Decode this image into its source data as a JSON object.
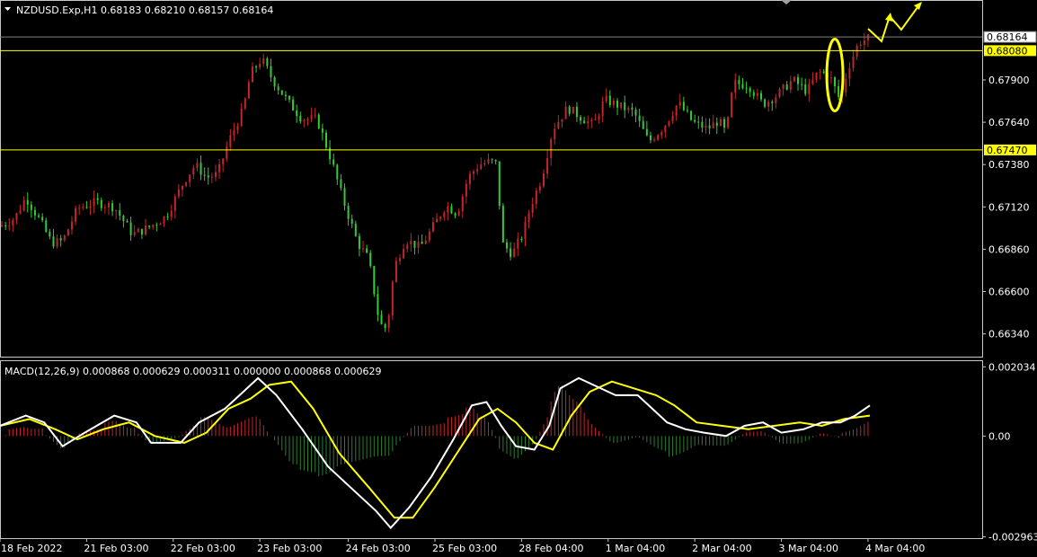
{
  "header": {
    "symbol_line": "NZDUSD.Exp,H1  0.68183 0.68210 0.68157 0.68164"
  },
  "macd_header": {
    "label": "MACD(12,26,9) 0.000868 0.000629 0.000311 0.000000 0.000868 0.000629"
  },
  "colors": {
    "background": "#000000",
    "bull_candle": "#c1272d",
    "bear_candle": "#32cd32",
    "horizontal_level": "#ffff00",
    "price_line": "#808080",
    "macd_line": "#ffffff",
    "signal_line": "#ffff00",
    "hist_positive": "#c1272d",
    "hist_negative": "#2e7d32",
    "annotation": "#ffff00"
  },
  "chart_data": [
    {
      "type": "candlestick",
      "symbol": "NZDUSD.Exp",
      "timeframe": "H1",
      "last_ohlc": {
        "open": 0.68183,
        "high": 0.6821,
        "low": 0.68157,
        "close": 0.68164
      },
      "ylim": [
        0.662,
        0.6838
      ],
      "y_ticks": [
        "0.68164",
        "0.67900",
        "0.67640",
        "0.67380",
        "0.67120",
        "0.66860",
        "0.66600",
        "0.66340"
      ],
      "x_ticks": [
        "18 Feb 2022",
        "21 Feb 03:00",
        "22 Feb 03:00",
        "23 Feb 03:00",
        "24 Feb 03:00",
        "25 Feb 03:00",
        "28 Feb 04:00",
        "1 Mar 04:00",
        "2 Mar 04:00",
        "3 Mar 04:00",
        "4 Mar 04:00"
      ],
      "current_price": {
        "value": 0.68164,
        "label": "0.68164"
      },
      "horizontal_levels": [
        {
          "value": 0.6808,
          "label": "0.68080"
        },
        {
          "value": 0.6747,
          "label": "0.67470"
        }
      ],
      "price_path": [
        {
          "x": 0,
          "y": 0.67
        },
        {
          "x": 8,
          "y": 0.6705
        },
        {
          "x": 14,
          "y": 0.6718
        },
        {
          "x": 22,
          "y": 0.6703
        },
        {
          "x": 28,
          "y": 0.669
        },
        {
          "x": 34,
          "y": 0.6691
        },
        {
          "x": 42,
          "y": 0.6711
        },
        {
          "x": 52,
          "y": 0.6715
        },
        {
          "x": 62,
          "y": 0.6712
        },
        {
          "x": 72,
          "y": 0.6695
        },
        {
          "x": 80,
          "y": 0.6699
        },
        {
          "x": 90,
          "y": 0.6706
        },
        {
          "x": 100,
          "y": 0.6728
        },
        {
          "x": 106,
          "y": 0.6738
        },
        {
          "x": 112,
          "y": 0.673
        },
        {
          "x": 118,
          "y": 0.6732
        },
        {
          "x": 124,
          "y": 0.6752
        },
        {
          "x": 132,
          "y": 0.6772
        },
        {
          "x": 136,
          "y": 0.6794
        },
        {
          "x": 142,
          "y": 0.6803
        },
        {
          "x": 148,
          "y": 0.679
        },
        {
          "x": 156,
          "y": 0.6777
        },
        {
          "x": 164,
          "y": 0.6766
        },
        {
          "x": 172,
          "y": 0.6766
        },
        {
          "x": 180,
          "y": 0.674
        },
        {
          "x": 186,
          "y": 0.6717
        },
        {
          "x": 194,
          "y": 0.669
        },
        {
          "x": 200,
          "y": 0.668
        },
        {
          "x": 206,
          "y": 0.664
        },
        {
          "x": 210,
          "y": 0.6637
        },
        {
          "x": 214,
          "y": 0.6675
        },
        {
          "x": 220,
          "y": 0.6692
        },
        {
          "x": 228,
          "y": 0.6687
        },
        {
          "x": 234,
          "y": 0.6698
        },
        {
          "x": 242,
          "y": 0.6713
        },
        {
          "x": 248,
          "y": 0.6708
        },
        {
          "x": 254,
          "y": 0.673
        },
        {
          "x": 260,
          "y": 0.6738
        },
        {
          "x": 266,
          "y": 0.674
        },
        {
          "x": 270,
          "y": 0.6738
        },
        {
          "x": 272,
          "y": 0.669
        },
        {
          "x": 278,
          "y": 0.6683
        },
        {
          "x": 284,
          "y": 0.6696
        },
        {
          "x": 288,
          "y": 0.6713
        },
        {
          "x": 294,
          "y": 0.673
        },
        {
          "x": 300,
          "y": 0.676
        },
        {
          "x": 308,
          "y": 0.6773
        },
        {
          "x": 314,
          "y": 0.6768
        },
        {
          "x": 322,
          "y": 0.6762
        },
        {
          "x": 328,
          "y": 0.6778
        },
        {
          "x": 336,
          "y": 0.6774
        },
        {
          "x": 344,
          "y": 0.677
        },
        {
          "x": 352,
          "y": 0.6752
        },
        {
          "x": 360,
          "y": 0.6761
        },
        {
          "x": 368,
          "y": 0.6776
        },
        {
          "x": 376,
          "y": 0.6764
        },
        {
          "x": 384,
          "y": 0.676
        },
        {
          "x": 390,
          "y": 0.6765
        },
        {
          "x": 394,
          "y": 0.6757
        },
        {
          "x": 398,
          "y": 0.6788
        },
        {
          "x": 406,
          "y": 0.6787
        },
        {
          "x": 414,
          "y": 0.6775
        },
        {
          "x": 422,
          "y": 0.6781
        },
        {
          "x": 430,
          "y": 0.679
        },
        {
          "x": 438,
          "y": 0.6783
        },
        {
          "x": 444,
          "y": 0.6795
        },
        {
          "x": 450,
          "y": 0.6793
        },
        {
          "x": 456,
          "y": 0.6777
        },
        {
          "x": 460,
          "y": 0.6797
        },
        {
          "x": 466,
          "y": 0.6813
        },
        {
          "x": 472,
          "y": 0.6816
        }
      ],
      "annotations": [
        {
          "type": "ellipse",
          "label": "highlighted breakout"
        },
        {
          "type": "zigzag-arrow",
          "label": "projected move up"
        }
      ]
    },
    {
      "type": "macd",
      "params": "MACD(12,26,9)",
      "values": {
        "macd": 0.000868,
        "signal": 0.000629,
        "histogram": 0.000311
      },
      "ylim": [
        -0.003,
        0.0022
      ],
      "y_ticks": [
        "0.002034",
        "0.00",
        "-0.002963"
      ],
      "macd_path": [
        {
          "x": 0,
          "y": 0.0003
        },
        {
          "x": 14,
          "y": 0.0006
        },
        {
          "x": 24,
          "y": 0.0004
        },
        {
          "x": 34,
          "y": -0.0003
        },
        {
          "x": 46,
          "y": 0.0001
        },
        {
          "x": 62,
          "y": 0.0006
        },
        {
          "x": 74,
          "y": 0.0004
        },
        {
          "x": 82,
          "y": -0.0002
        },
        {
          "x": 98,
          "y": -0.0002
        },
        {
          "x": 108,
          "y": 0.0004
        },
        {
          "x": 122,
          "y": 0.0008
        },
        {
          "x": 132,
          "y": 0.0013
        },
        {
          "x": 140,
          "y": 0.0017
        },
        {
          "x": 150,
          "y": 0.0012
        },
        {
          "x": 164,
          "y": 0.0002
        },
        {
          "x": 178,
          "y": -0.0009
        },
        {
          "x": 190,
          "y": -0.0015
        },
        {
          "x": 204,
          "y": -0.0022
        },
        {
          "x": 212,
          "y": -0.0027
        },
        {
          "x": 222,
          "y": -0.0021
        },
        {
          "x": 234,
          "y": -0.0012
        },
        {
          "x": 246,
          "y": -0.0001
        },
        {
          "x": 256,
          "y": 0.0009
        },
        {
          "x": 264,
          "y": 0.001
        },
        {
          "x": 272,
          "y": 0.0003
        },
        {
          "x": 280,
          "y": -0.0003
        },
        {
          "x": 290,
          "y": -0.0004
        },
        {
          "x": 298,
          "y": 0.0003
        },
        {
          "x": 304,
          "y": 0.0014
        },
        {
          "x": 314,
          "y": 0.0017
        },
        {
          "x": 322,
          "y": 0.0015
        },
        {
          "x": 334,
          "y": 0.0012
        },
        {
          "x": 346,
          "y": 0.0012
        },
        {
          "x": 354,
          "y": 0.0008
        },
        {
          "x": 362,
          "y": 0.0004
        },
        {
          "x": 372,
          "y": 0.0002
        },
        {
          "x": 382,
          "y": 0.0001
        },
        {
          "x": 394,
          "y": 0.0
        },
        {
          "x": 404,
          "y": 0.0003
        },
        {
          "x": 414,
          "y": 0.0004
        },
        {
          "x": 424,
          "y": 0.0001
        },
        {
          "x": 436,
          "y": 0.0002
        },
        {
          "x": 446,
          "y": 0.0004
        },
        {
          "x": 456,
          "y": 0.0004
        },
        {
          "x": 464,
          "y": 0.0006
        },
        {
          "x": 472,
          "y": 0.0009
        }
      ],
      "signal_path": [
        {
          "x": 0,
          "y": 0.0003
        },
        {
          "x": 16,
          "y": 0.0005
        },
        {
          "x": 30,
          "y": 0.0002
        },
        {
          "x": 42,
          "y": -0.0001
        },
        {
          "x": 56,
          "y": 0.0002
        },
        {
          "x": 70,
          "y": 0.0004
        },
        {
          "x": 84,
          "y": 0.0
        },
        {
          "x": 100,
          "y": -0.0002
        },
        {
          "x": 112,
          "y": 0.0001
        },
        {
          "x": 124,
          "y": 0.0008
        },
        {
          "x": 136,
          "y": 0.0011
        },
        {
          "x": 146,
          "y": 0.0015
        },
        {
          "x": 158,
          "y": 0.0016
        },
        {
          "x": 170,
          "y": 0.0008
        },
        {
          "x": 184,
          "y": -0.0005
        },
        {
          "x": 200,
          "y": -0.0015
        },
        {
          "x": 214,
          "y": -0.0024
        },
        {
          "x": 224,
          "y": -0.0024
        },
        {
          "x": 236,
          "y": -0.0015
        },
        {
          "x": 248,
          "y": -0.0005
        },
        {
          "x": 260,
          "y": 0.0005
        },
        {
          "x": 270,
          "y": 0.0008
        },
        {
          "x": 280,
          "y": 0.0004
        },
        {
          "x": 290,
          "y": -0.0002
        },
        {
          "x": 300,
          "y": -0.0004
        },
        {
          "x": 310,
          "y": 0.0006
        },
        {
          "x": 320,
          "y": 0.0013
        },
        {
          "x": 332,
          "y": 0.0016
        },
        {
          "x": 344,
          "y": 0.0014
        },
        {
          "x": 356,
          "y": 0.0012
        },
        {
          "x": 366,
          "y": 0.0009
        },
        {
          "x": 378,
          "y": 0.0004
        },
        {
          "x": 392,
          "y": 0.0003
        },
        {
          "x": 406,
          "y": 0.0002
        },
        {
          "x": 420,
          "y": 0.0003
        },
        {
          "x": 434,
          "y": 0.0004
        },
        {
          "x": 446,
          "y": 0.0003
        },
        {
          "x": 458,
          "y": 0.0005
        },
        {
          "x": 472,
          "y": 0.0006
        }
      ]
    }
  ]
}
